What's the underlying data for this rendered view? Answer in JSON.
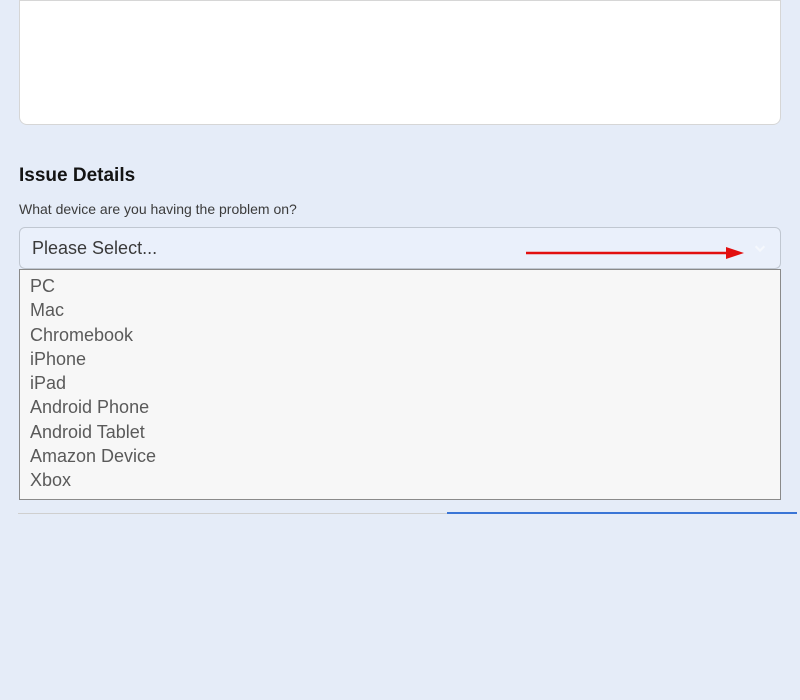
{
  "form": {
    "section_title": "Issue Details",
    "device_question": "What device are you having the problem on?",
    "select": {
      "placeholder": "Please Select...",
      "options": [
        "PC",
        "Mac",
        "Chromebook",
        "iPhone",
        "iPad",
        "Android Phone",
        "Android Tablet",
        "Amazon Device",
        "Xbox"
      ]
    }
  }
}
